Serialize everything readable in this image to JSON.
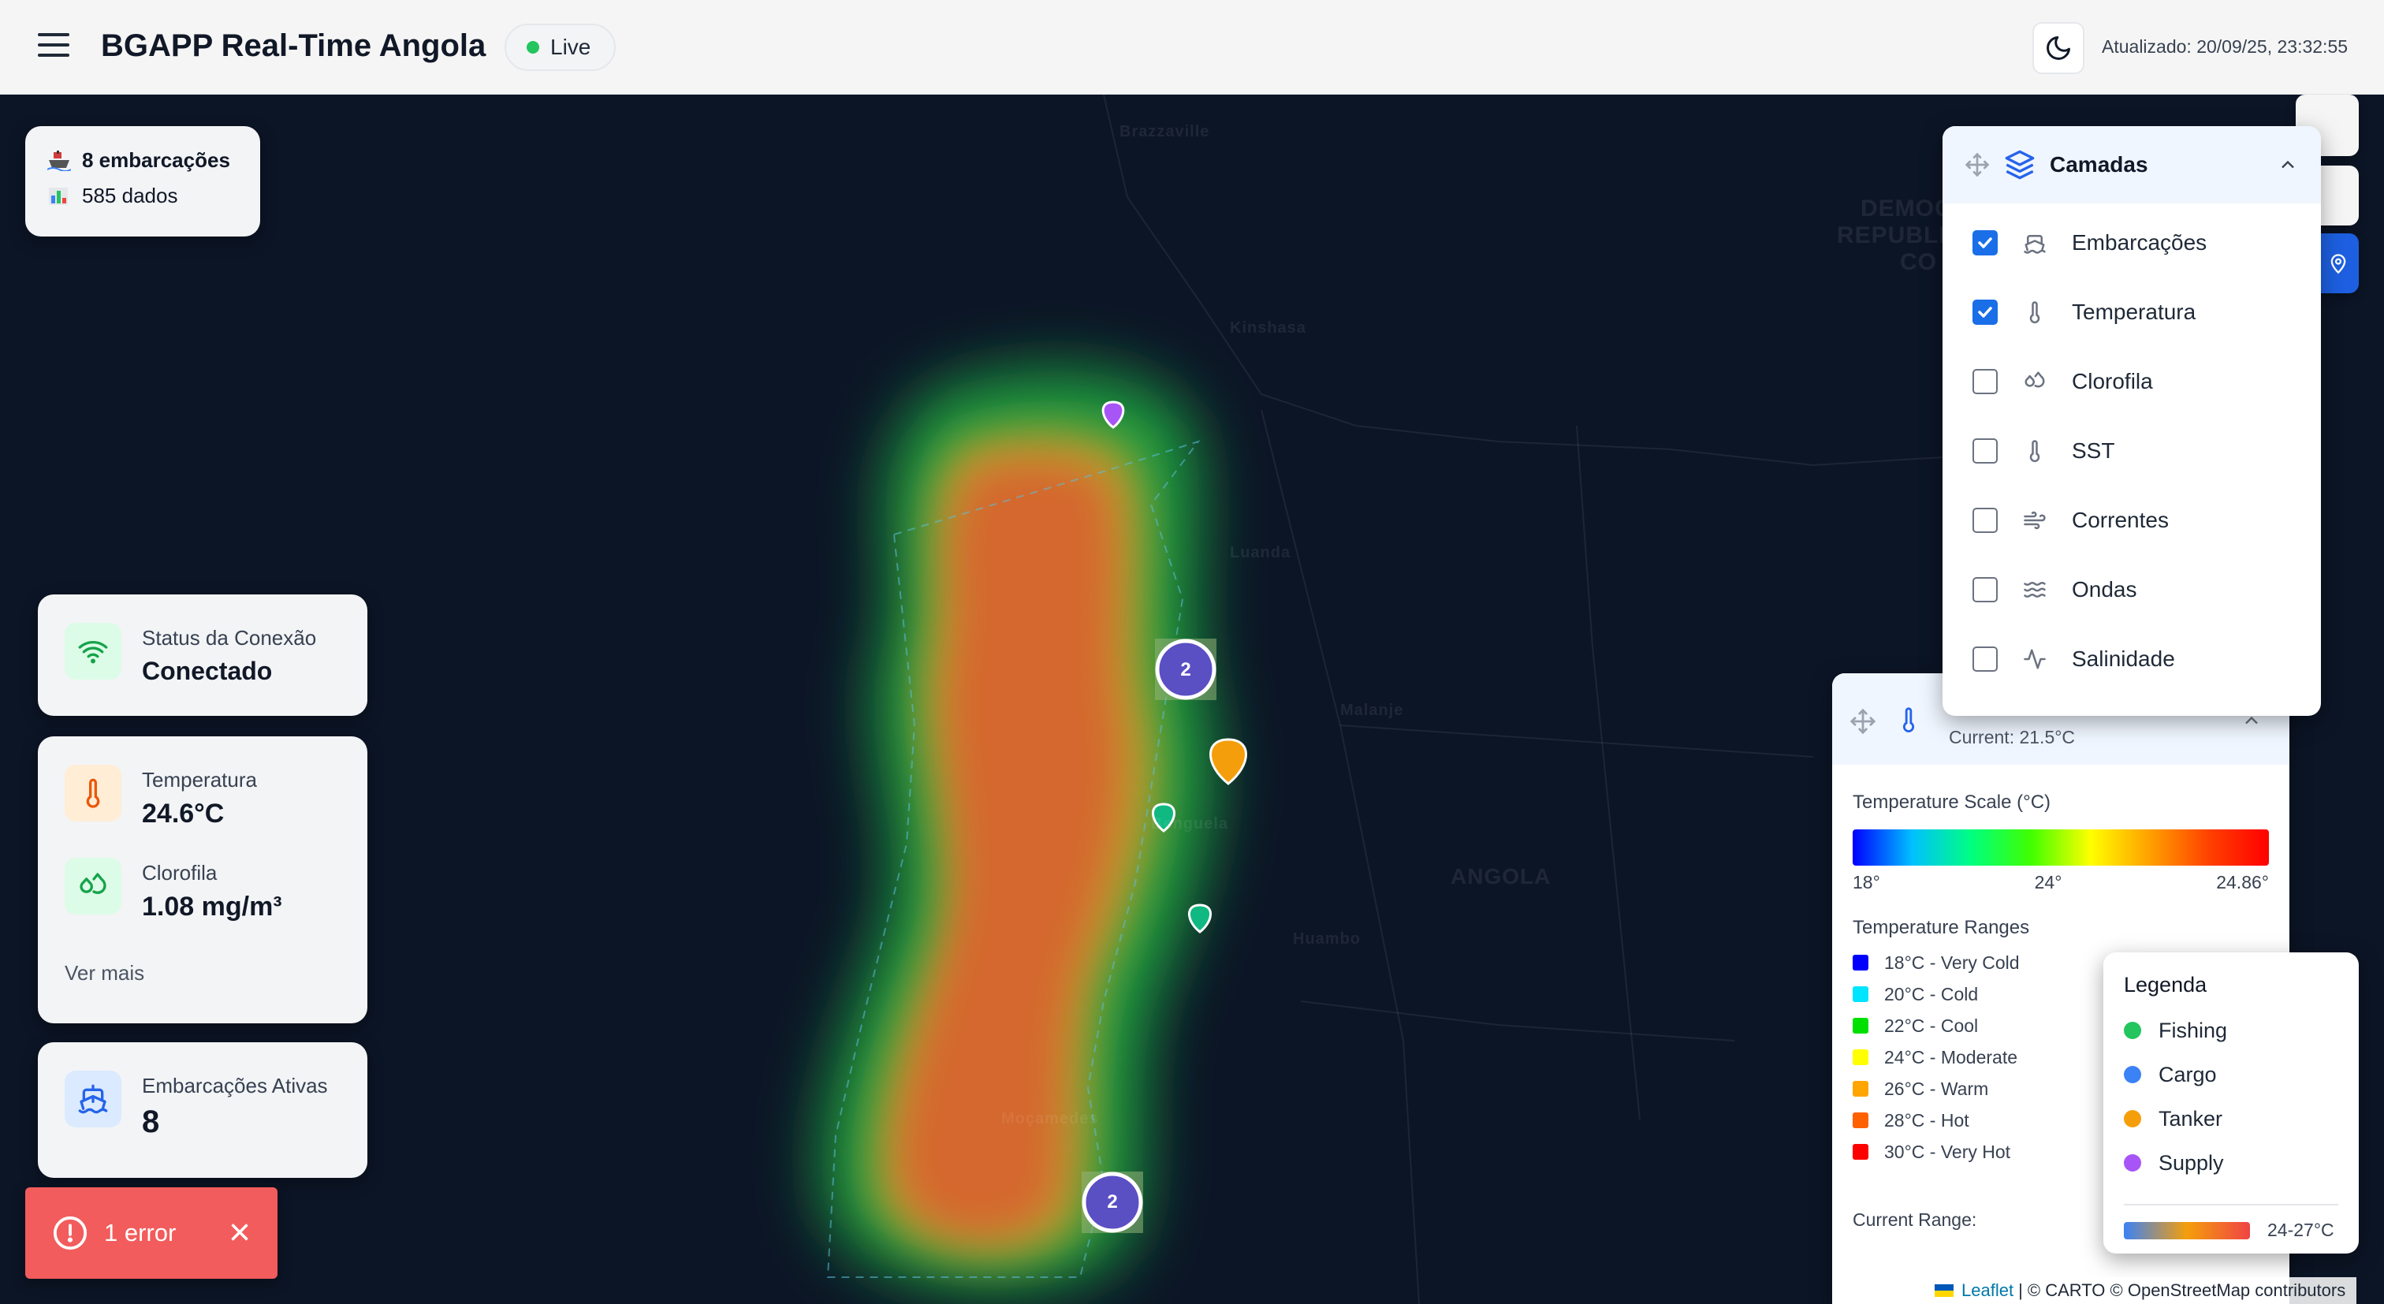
{
  "header": {
    "title": "BGAPP Real-Time Angola",
    "live_label": "Live",
    "updated": "Atualizado: 20/09/25, 23:32:55"
  },
  "summary": {
    "vessels": "8 embarcações",
    "data": "585 dados"
  },
  "connection": {
    "label": "Status da Conexão",
    "value": "Conectado"
  },
  "environment": {
    "temp_label": "Temperatura",
    "temp_value": "24.6°C",
    "chl_label": "Clorofila",
    "chl_value": "1.08 mg/m³",
    "see_more": "Ver mais"
  },
  "fleet": {
    "label": "Embarcações Ativas",
    "value": "8"
  },
  "error": {
    "label": "1 error"
  },
  "layers": {
    "title": "Camadas",
    "items": [
      {
        "label": "Embarcações",
        "checked": true,
        "icon": "ship-icon"
      },
      {
        "label": "Temperatura",
        "checked": true,
        "icon": "thermometer-icon"
      },
      {
        "label": "Clorofila",
        "checked": false,
        "icon": "droplets-icon"
      },
      {
        "label": "SST",
        "checked": false,
        "icon": "thermometer-icon"
      },
      {
        "label": "Correntes",
        "checked": false,
        "icon": "wind-icon"
      },
      {
        "label": "Ondas",
        "checked": false,
        "icon": "waves-icon"
      },
      {
        "label": "Salinidade",
        "checked": false,
        "icon": "activity-icon"
      }
    ]
  },
  "temperature_panel": {
    "current": "Current: 21.5°C",
    "scale_title": "Temperature Scale (°C)",
    "scale_ticks": [
      "18°",
      "24°",
      "24.86°"
    ],
    "ranges_title": "Temperature Ranges",
    "ranges": [
      {
        "label": "18°C - Very Cold",
        "color": "#0000ff"
      },
      {
        "label": "20°C - Cold",
        "color": "#00e5ff"
      },
      {
        "label": "22°C - Cool",
        "color": "#00e000"
      },
      {
        "label": "24°C - Moderate",
        "color": "#ffff00"
      },
      {
        "label": "26°C - Warm",
        "color": "#ffa500"
      },
      {
        "label": "28°C - Hot",
        "color": "#ff6000"
      },
      {
        "label": "30°C - Very Hot",
        "color": "#ff0000"
      }
    ],
    "current_range_label": "Current Range:"
  },
  "legend": {
    "title": "Legenda",
    "items": [
      {
        "label": "Fishing",
        "color": "#22c55e"
      },
      {
        "label": "Cargo",
        "color": "#3b82f6"
      },
      {
        "label": "Tanker",
        "color": "#f59e0b"
      },
      {
        "label": "Supply",
        "color": "#a855f7"
      }
    ],
    "range": "24-27°C"
  },
  "map": {
    "cluster_a": "2",
    "cluster_b": "2",
    "labels": [
      "Brazzaville",
      "Kinshasa",
      "DEMOCRATIC",
      "REPUBLIC",
      "CO",
      "ANGOLA",
      "Luanda",
      "Moçamedes",
      "Malanje",
      "Benguela",
      "Huambo"
    ]
  },
  "attribution": {
    "leaflet": "Leaflet",
    "rest": "| © CARTO © OpenStreetMap contributors"
  }
}
